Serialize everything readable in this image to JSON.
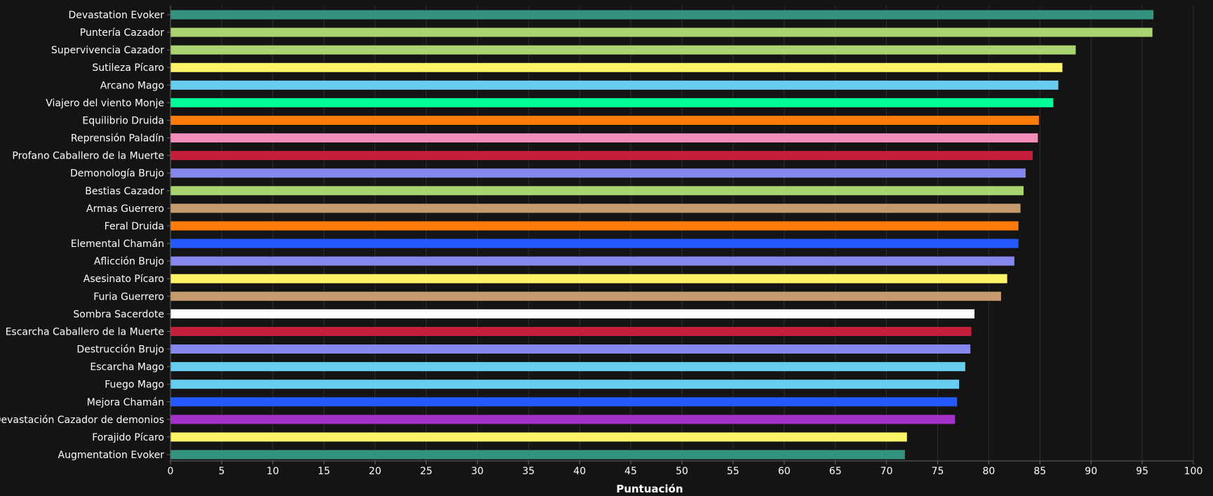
{
  "chart_data": {
    "type": "bar",
    "orientation": "horizontal",
    "title": "",
    "xlabel": "Puntuación",
    "ylabel": "",
    "xlim": [
      0,
      100
    ],
    "xticks": [
      0,
      5,
      10,
      15,
      20,
      25,
      30,
      35,
      40,
      45,
      50,
      55,
      60,
      65,
      70,
      75,
      80,
      85,
      90,
      95,
      100
    ],
    "grid": "vertical",
    "categories": [
      "Devastation Evoker",
      "Puntería Cazador",
      "Supervivencia Cazador",
      "Sutileza Pícaro",
      "Arcano Mago",
      "Viajero del viento Monje",
      "Equilibrio Druida",
      "Reprensión Paladín",
      "Profano Caballero de la Muerte",
      "Demonología Brujo",
      "Bestias Cazador",
      "Armas Guerrero",
      "Feral Druida",
      "Elemental Chamán",
      "Aflicción Brujo",
      "Asesinato Pícaro",
      "Furia Guerrero",
      "Sombra Sacerdote",
      "Escarcha Caballero de la Muerte",
      "Destrucción Brujo",
      "Escarcha Mago",
      "Fuego Mago",
      "Mejora Chamán",
      "Devastación Cazador de demonios",
      "Forajido Pícaro",
      "Augmentation Evoker"
    ],
    "values": [
      96.1,
      96.0,
      88.5,
      87.2,
      86.8,
      86.3,
      84.9,
      84.8,
      84.3,
      83.6,
      83.4,
      83.1,
      82.9,
      82.9,
      82.5,
      81.8,
      81.2,
      78.6,
      78.3,
      78.2,
      77.7,
      77.1,
      76.9,
      76.7,
      72.0,
      71.8
    ],
    "colors": [
      "#33937F",
      "#AAD372",
      "#AAD372",
      "#FFF468",
      "#68CCEF",
      "#00FF98",
      "#FF7C0A",
      "#F48CBA",
      "#C41E3A",
      "#8788EE",
      "#AAD372",
      "#C69B6D",
      "#FF7C0A",
      "#2459FF",
      "#8788EE",
      "#FFF468",
      "#C69B6D",
      "#FFFFFF",
      "#C41E3A",
      "#8788EE",
      "#68CCEF",
      "#68CCEF",
      "#2459FF",
      "#A330C9",
      "#FFF468",
      "#33937F"
    ]
  }
}
